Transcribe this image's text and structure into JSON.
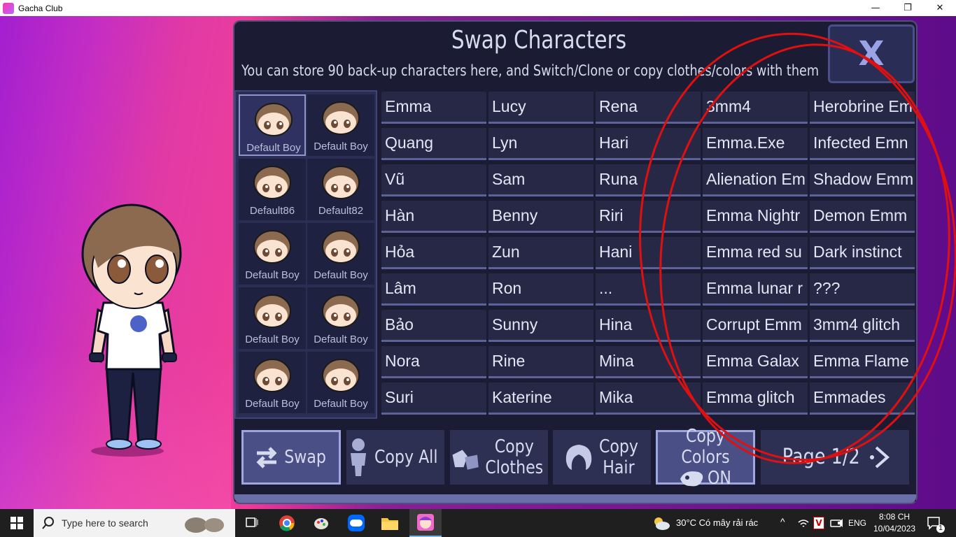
{
  "window": {
    "title": "Gacha Club",
    "minimize": "—",
    "maximize": "❐",
    "close": "✕"
  },
  "panel": {
    "title": "Swap Characters",
    "subtitle": "You can store 90 back-up characters here, and Switch/Clone or copy clothes/colors with them",
    "close_label": "X"
  },
  "presets": [
    {
      "label": "Default Boy",
      "selected": true
    },
    {
      "label": "Default Boy"
    },
    {
      "label": "Default86"
    },
    {
      "label": "Default82"
    },
    {
      "label": "Default Boy"
    },
    {
      "label": "Default Boy"
    },
    {
      "label": "Default Boy"
    },
    {
      "label": "Default Boy"
    },
    {
      "label": "Default Boy"
    },
    {
      "label": "Default Boy"
    }
  ],
  "slots": [
    [
      "Emma",
      "Lucy",
      "Rena",
      "3mm4",
      "Herobrine Em"
    ],
    [
      "Quang",
      "Lyn",
      "Hari",
      "Emma.Exe",
      "Infected Emn"
    ],
    [
      "Vũ",
      "Sam",
      "Runa",
      "Alienation Em",
      "Shadow Emm"
    ],
    [
      "Hàn",
      "Benny",
      "Riri",
      "Emma Nightr",
      "Demon Emm"
    ],
    [
      "Hỏa",
      "Zun",
      "Hani",
      "Emma red su",
      "Dark instinct"
    ],
    [
      "Lâm",
      "Ron",
      "...",
      "Emma lunar r",
      "???"
    ],
    [
      "Bảo",
      "Sunny",
      "Hina",
      "Corrupt Emm",
      "3mm4 glitch"
    ],
    [
      "Nora",
      "Rine",
      "Mina",
      "Emma Galax",
      "Emma Flame"
    ],
    [
      "Suri",
      "Katerine",
      "Mika",
      "Emma glitch",
      "Emmades"
    ]
  ],
  "toolbar": {
    "swap": "Swap",
    "copy_all": "Copy All",
    "copy_clothes_1": "Copy",
    "copy_clothes_2": "Clothes",
    "copy_hair_1": "Copy",
    "copy_hair_2": "Hair",
    "copy_colors_1": "Copy Colors",
    "copy_colors_2": "ON",
    "page": "Page 1/2"
  },
  "taskbar": {
    "search_placeholder": "Type here to search",
    "weather": "30°C  Có mây rải rác",
    "language": "ENG",
    "time": "8:08 CH",
    "date": "10/04/2023",
    "notification_count": "1"
  },
  "colors": {
    "panel_bg": "#1b1c33",
    "slot_bg": "#262845",
    "annotation": "#e01010"
  }
}
